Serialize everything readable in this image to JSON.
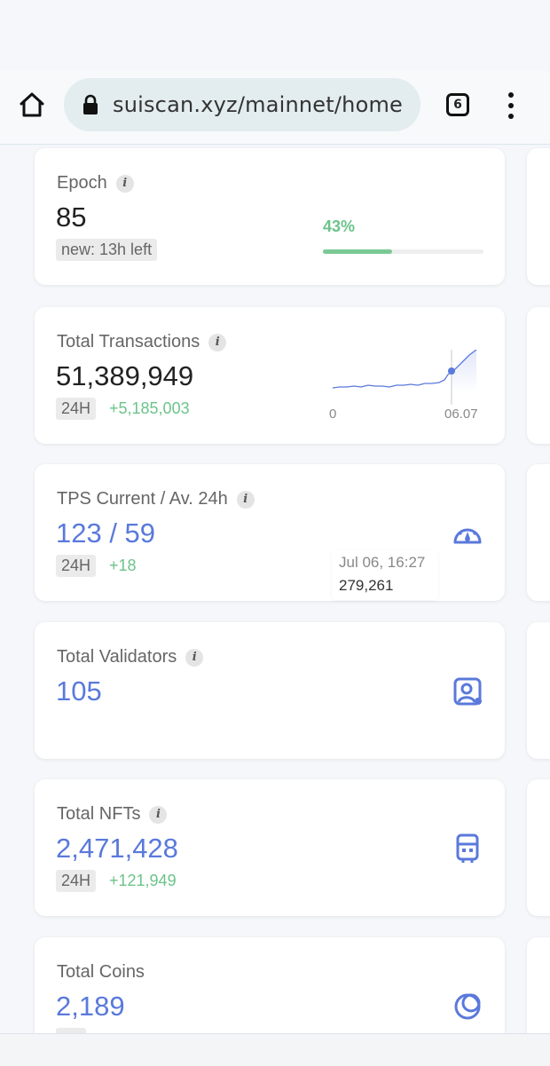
{
  "browser": {
    "url": "suiscan.xyz/mainnet/home",
    "tab_count": "6"
  },
  "cards": {
    "epoch": {
      "label": "Epoch",
      "value": "85",
      "badge": "new: 13h left",
      "progress_text": "43%",
      "progress": 0.43
    },
    "transactions": {
      "label": "Total Transactions",
      "value": "51,389,949",
      "badge": "24H",
      "delta": "+5,185,003",
      "chart_x_start": "0",
      "chart_x_end": "06.07",
      "tooltip_date": "Jul 06, 16:27",
      "tooltip_value": "279,261"
    },
    "tps": {
      "label": "TPS Current / Av. 24h",
      "value": "123 / 59",
      "badge": "24H",
      "delta": "+18",
      "icon": "speedometer-icon"
    },
    "validators": {
      "label": "Total Validators",
      "value": "105",
      "icon": "validator-profile-icon"
    },
    "nfts": {
      "label": "Total NFTs",
      "value": "2,471,428",
      "badge": "24H",
      "delta": "+121,949",
      "icon": "nft-icon"
    },
    "coins": {
      "label": "Total Coins",
      "value": "2,189",
      "icon": "coin-icon"
    }
  },
  "colors": {
    "accent_blue": "#5a79db",
    "positive_green": "#6cc38a"
  }
}
